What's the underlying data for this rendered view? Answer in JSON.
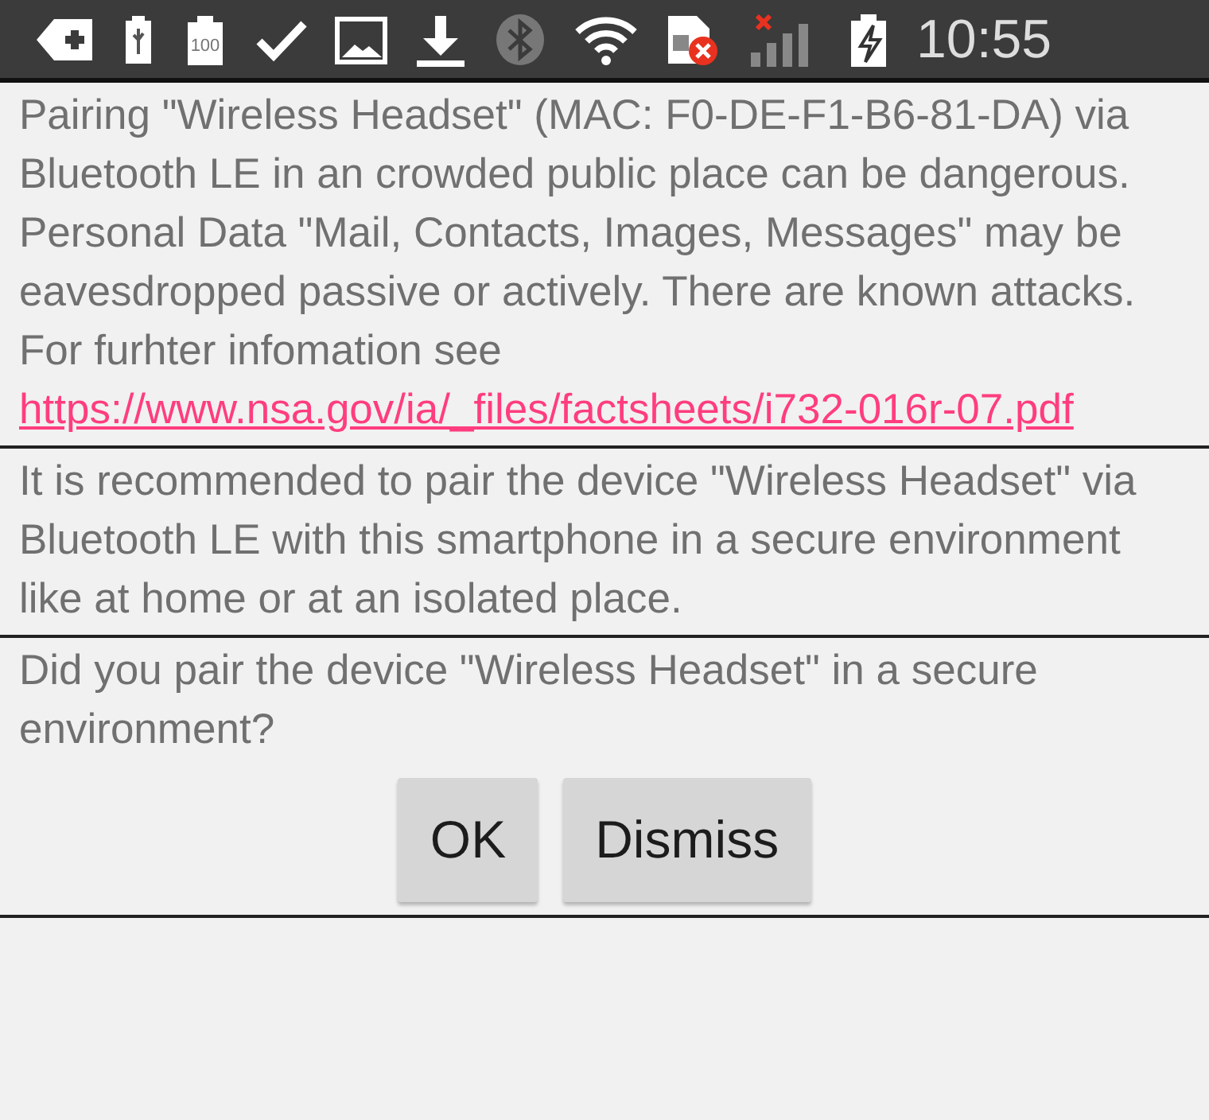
{
  "status_bar": {
    "battery_level_text": "100",
    "time": "10:55"
  },
  "sections": [
    {
      "text": "Pairing \"Wireless Headset\" (MAC: F0-DE-F1-B6-81-DA) via Bluetooth LE in an crowded public place can be dangerous. Personal Data \"Mail, Contacts, Images, Messages\" may be eavesdropped passive or actively. There are known attacks. For furhter infomation see",
      "link": "https://www.nsa.gov/ia/_files/factsheets/i732-016r-07.pdf"
    },
    {
      "text": "It is recommended to pair the device \"Wireless Headset\" via Bluetooth LE with this smartphone in a secure environment like at home or at an isolated place."
    },
    {
      "text": "Did you pair the device \"Wireless Headset\" in a secure environment?"
    }
  ],
  "buttons": [
    "OK",
    "Dismiss"
  ]
}
